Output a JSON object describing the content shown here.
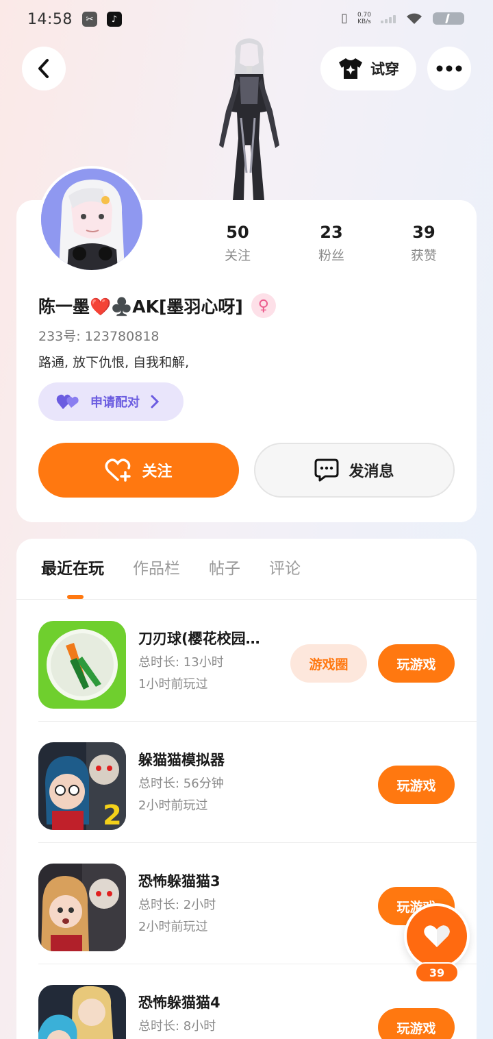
{
  "status_bar": {
    "time": "14:58",
    "net_speed": "0.70",
    "net_unit": "KB/s"
  },
  "header": {
    "tryon_label": "试穿"
  },
  "profile": {
    "name": "陈一墨❤️♣️AK[墨羽心呀]",
    "gender_symbol": "♀",
    "uid": "233号: 123780818",
    "bio": "路通, 放下仇恨, 自我和解,",
    "stats": [
      {
        "value": "50",
        "label": "关注"
      },
      {
        "value": "23",
        "label": "粉丝"
      },
      {
        "value": "39",
        "label": "获赞"
      }
    ],
    "pair_label": "申请配对",
    "follow_label": "关注",
    "message_label": "发消息"
  },
  "tabs": [
    "最近在玩",
    "作品栏",
    "帖子",
    "评论"
  ],
  "games": [
    {
      "title": "刀刃球(樱花校园…",
      "duration": "总时长: 13小时",
      "last_played": "1小时前玩过",
      "circle_label": "游戏圈",
      "play_label": "玩游戏"
    },
    {
      "title": "躲猫猫模拟器",
      "duration": "总时长: 56分钟",
      "last_played": "2小时前玩过",
      "play_label": "玩游戏"
    },
    {
      "title": "恐怖躲猫猫3",
      "duration": "总时长: 2小时",
      "last_played": "2小时前玩过",
      "play_label": "玩游戏"
    },
    {
      "title": "恐怖躲猫猫4",
      "duration": "总时长: 8小时",
      "play_label": "玩游戏"
    }
  ],
  "like_fab": {
    "count": "39"
  },
  "colors": {
    "accent": "#ff7810",
    "pair": "#6b5ce0"
  }
}
